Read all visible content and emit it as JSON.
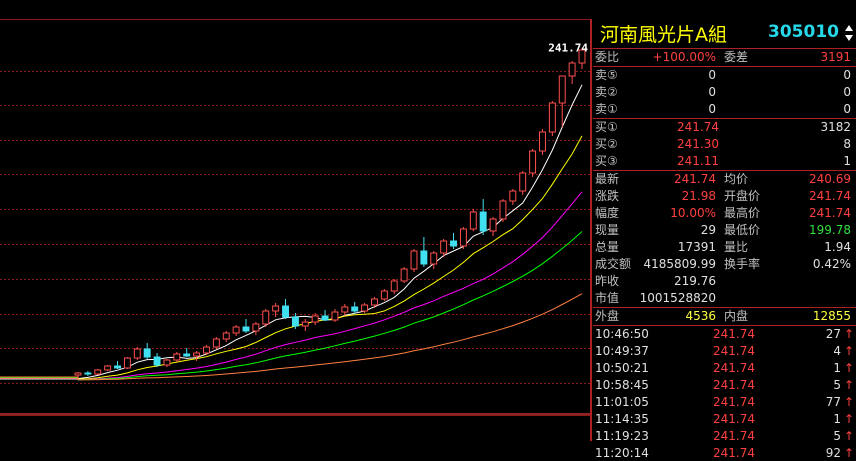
{
  "header": {
    "name": "河南風光片A組",
    "code": "305010"
  },
  "chart": {
    "last_price_label": "241.74",
    "candles": [
      [
        209,
        209.3,
        208.8,
        209.2
      ],
      [
        209.2,
        209.4,
        208.9,
        209.1
      ],
      [
        209.1,
        209.6,
        209.0,
        209.5
      ],
      [
        209.5,
        210.0,
        209.4,
        209.9
      ],
      [
        209.9,
        210.4,
        209.6,
        209.7
      ],
      [
        209.7,
        210.8,
        209.6,
        210.7
      ],
      [
        210.7,
        211.8,
        210.5,
        211.6
      ],
      [
        211.6,
        212.2,
        210.6,
        210.8
      ],
      [
        210.8,
        211.2,
        209.8,
        210.0
      ],
      [
        210.0,
        210.6,
        209.8,
        210.5
      ],
      [
        210.5,
        211.3,
        210.3,
        211.1
      ],
      [
        211.1,
        211.7,
        210.8,
        210.9
      ],
      [
        210.9,
        211.4,
        210.4,
        211.2
      ],
      [
        211.2,
        212.0,
        211.0,
        211.8
      ],
      [
        211.8,
        212.8,
        211.6,
        212.6
      ],
      [
        212.6,
        213.4,
        212.3,
        213.2
      ],
      [
        213.2,
        214.0,
        212.9,
        213.8
      ],
      [
        213.8,
        214.6,
        213.2,
        213.4
      ],
      [
        213.4,
        214.3,
        213.0,
        214.1
      ],
      [
        214.1,
        215.6,
        213.8,
        215.4
      ],
      [
        215.4,
        216.2,
        214.8,
        215.9
      ],
      [
        215.9,
        216.6,
        214.6,
        214.8
      ],
      [
        214.8,
        215.2,
        213.6,
        213.9
      ],
      [
        213.9,
        214.6,
        213.4,
        214.3
      ],
      [
        214.3,
        215.2,
        214.0,
        214.9
      ],
      [
        214.9,
        215.5,
        214.4,
        214.5
      ],
      [
        214.5,
        215.6,
        214.3,
        215.3
      ],
      [
        215.3,
        216.1,
        214.9,
        215.8
      ],
      [
        215.8,
        216.3,
        215.1,
        215.4
      ],
      [
        215.4,
        216.2,
        215.2,
        216.0
      ],
      [
        216.0,
        216.8,
        215.7,
        216.6
      ],
      [
        216.6,
        217.6,
        216.4,
        217.4
      ],
      [
        217.4,
        218.6,
        217.1,
        218.4
      ],
      [
        218.4,
        219.8,
        218.2,
        219.6
      ],
      [
        219.6,
        221.6,
        219.3,
        221.4
      ],
      [
        221.4,
        222.8,
        219.8,
        220.1
      ],
      [
        220.1,
        221.4,
        219.6,
        221.2
      ],
      [
        221.2,
        222.6,
        220.8,
        222.4
      ],
      [
        222.4,
        223.2,
        221.6,
        221.9
      ],
      [
        221.9,
        223.8,
        221.6,
        223.6
      ],
      [
        223.6,
        225.6,
        223.4,
        225.3
      ],
      [
        225.3,
        226.6,
        223.0,
        223.4
      ],
      [
        223.4,
        224.8,
        222.9,
        224.6
      ],
      [
        224.6,
        226.6,
        224.3,
        226.4
      ],
      [
        226.4,
        227.6,
        226.0,
        227.4
      ],
      [
        227.4,
        229.4,
        227.0,
        229.2
      ],
      [
        229.2,
        231.6,
        228.8,
        231.4
      ],
      [
        231.4,
        233.6,
        231.0,
        233.3
      ],
      [
        233.3,
        236.4,
        232.9,
        236.2
      ],
      [
        236.2,
        237.2,
        233.8,
        238.9
      ],
      [
        238.9,
        240.4,
        238.1,
        240.2
      ],
      [
        240.2,
        241.74,
        239.6,
        241.5
      ]
    ],
    "ma_lines": [
      {
        "name": "MA5",
        "color": "#ffffff"
      },
      {
        "name": "MA10",
        "color": "#ffff00"
      },
      {
        "name": "MA20",
        "color": "#ff00ff"
      },
      {
        "name": "MA30",
        "color": "#00ff00"
      },
      {
        "name": "MA60",
        "color": "#ff8040"
      }
    ]
  },
  "quote": {
    "weibi_label": "委比",
    "weibi_value": "+100.00%",
    "weicha_label": "委差",
    "weicha_value": "3191",
    "asks": [
      {
        "label": "卖⑤",
        "price": "",
        "vol": "0"
      },
      {
        "label": "卖②",
        "price": "",
        "vol": "0"
      },
      {
        "label": "卖①",
        "price": "",
        "vol": "0"
      }
    ],
    "bids": [
      {
        "label": "买①",
        "price": "241.74",
        "vol": "3182"
      },
      {
        "label": "买②",
        "price": "241.30",
        "vol": "8"
      },
      {
        "label": "买③",
        "price": "241.11",
        "vol": "1"
      }
    ],
    "stats": [
      {
        "l1": "最新",
        "v1": "241.74",
        "c1": "red",
        "l2": "均价",
        "v2": "240.69",
        "c2": "red"
      },
      {
        "l1": "涨跌",
        "v1": "21.98",
        "c1": "red",
        "l2": "开盘价",
        "v2": "241.74",
        "c2": "red"
      },
      {
        "l1": "幅度",
        "v1": "10.00%",
        "c1": "red",
        "l2": "最高价",
        "v2": "241.74",
        "c2": "red"
      },
      {
        "l1": "现量",
        "v1": "29",
        "c1": "white",
        "l2": "最低价",
        "v2": "199.78",
        "c2": "green"
      },
      {
        "l1": "总量",
        "v1": "17391",
        "c1": "white",
        "l2": "量比",
        "v2": "1.94",
        "c2": "white"
      },
      {
        "l1": "成交额",
        "v1": "4185809.99",
        "c1": "white",
        "l2": "换手率",
        "v2": "0.42%",
        "c2": "white"
      },
      {
        "l1": "昨收",
        "v1": "219.76",
        "c1": "white",
        "l2": "",
        "v2": "",
        "c2": "white"
      },
      {
        "l1": "市值",
        "v1": "1001528820",
        "c1": "white",
        "l2": "",
        "v2": "",
        "c2": "white"
      }
    ],
    "waipan_label": "外盘",
    "waipan_value": "4536",
    "neipan_label": "内盘",
    "neipan_value": "12855",
    "ticks": [
      {
        "time": "10:46:50",
        "price": "241.74",
        "vol": "27"
      },
      {
        "time": "10:49:37",
        "price": "241.74",
        "vol": "4"
      },
      {
        "time": "10:50:21",
        "price": "241.74",
        "vol": "1"
      },
      {
        "time": "10:58:45",
        "price": "241.74",
        "vol": "5"
      },
      {
        "time": "11:01:05",
        "price": "241.74",
        "vol": "77"
      },
      {
        "time": "11:14:35",
        "price": "241.74",
        "vol": "1"
      },
      {
        "time": "11:19:23",
        "price": "241.74",
        "vol": "5"
      },
      {
        "time": "11:20:14",
        "price": "241.74",
        "vol": "92"
      }
    ],
    "tick_arrow": "↑"
  }
}
